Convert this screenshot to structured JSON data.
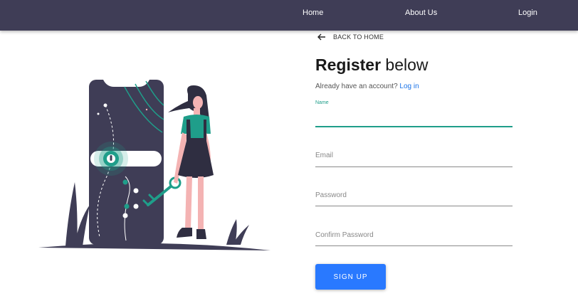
{
  "nav": {
    "home": "Home",
    "about": "About Us",
    "login": "Login"
  },
  "back": {
    "label": "BACK TO HOME",
    "icon": "arrow-left-icon"
  },
  "form": {
    "title_bold": "Register",
    "title_rest": " below",
    "already_text": "Already have an account? ",
    "login_link": "Log in",
    "fields": [
      {
        "label": "Name",
        "value": "",
        "focused": true
      },
      {
        "label": "Email",
        "value": ""
      },
      {
        "label": "Password",
        "value": ""
      },
      {
        "label": "Confirm Password",
        "value": ""
      }
    ],
    "submit_label": "SIGN UP"
  },
  "colors": {
    "navbar": "#3f3d56",
    "accent": "#1f9e8a",
    "button": "#2979ff",
    "skin": "#f4b3b3"
  },
  "illustration": {
    "name": "unlock-phone-illustration"
  }
}
